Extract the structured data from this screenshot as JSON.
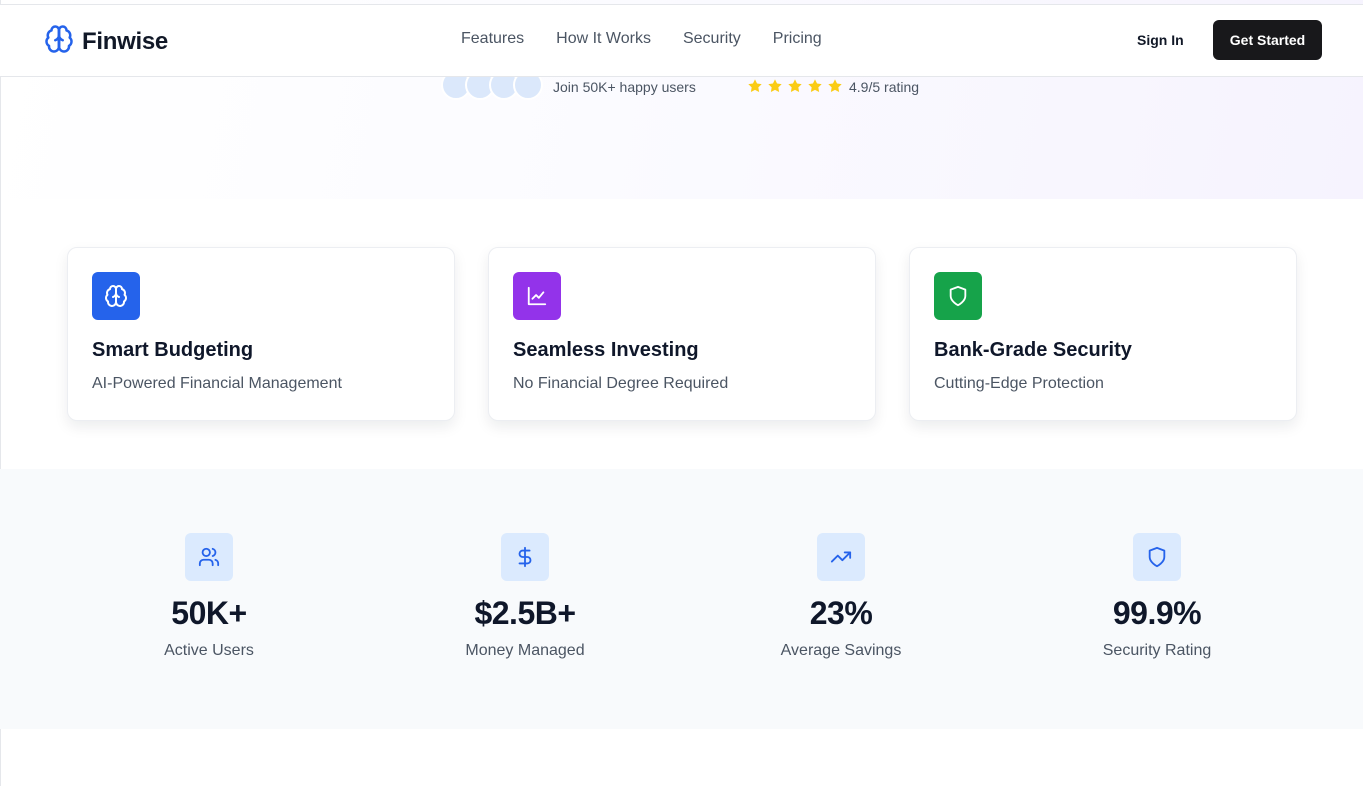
{
  "colors": {
    "accent_blue": "#2563eb",
    "accent_purple": "#9333ea",
    "accent_green": "#16a34a",
    "star": "#facc15",
    "dark_button": "#18181b",
    "stat_icon_bg": "#dbeafe"
  },
  "nav": {
    "logo_icon": "brain-icon",
    "brand": "Finwise",
    "links": [
      "Features",
      "How It Works",
      "Security",
      "Pricing"
    ],
    "sign_in": "Sign In",
    "get_started": "Get Started"
  },
  "hero": {
    "join_text": "Join 50K+ happy users",
    "rating_text": "4.9/5 rating",
    "stars_filled": 5,
    "stars_total": 5
  },
  "features": [
    {
      "icon": "brain-icon",
      "title": "Smart Budgeting",
      "subtitle": "AI-Powered Financial Management",
      "color": "#2563eb"
    },
    {
      "icon": "line-chart-icon",
      "title": "Seamless Investing",
      "subtitle": "No Financial Degree Required",
      "color": "#9333ea"
    },
    {
      "icon": "shield-icon",
      "title": "Bank-Grade Security",
      "subtitle": "Cutting-Edge Protection",
      "color": "#16a34a"
    }
  ],
  "stats": [
    {
      "icon": "users-icon",
      "value": "50K+",
      "label": "Active Users"
    },
    {
      "icon": "dollar-icon",
      "value": "$2.5B+",
      "label": "Money Managed"
    },
    {
      "icon": "trending-up-icon",
      "value": "23%",
      "label": "Average Savings"
    },
    {
      "icon": "shield-icon",
      "value": "99.9%",
      "label": "Security Rating"
    }
  ]
}
